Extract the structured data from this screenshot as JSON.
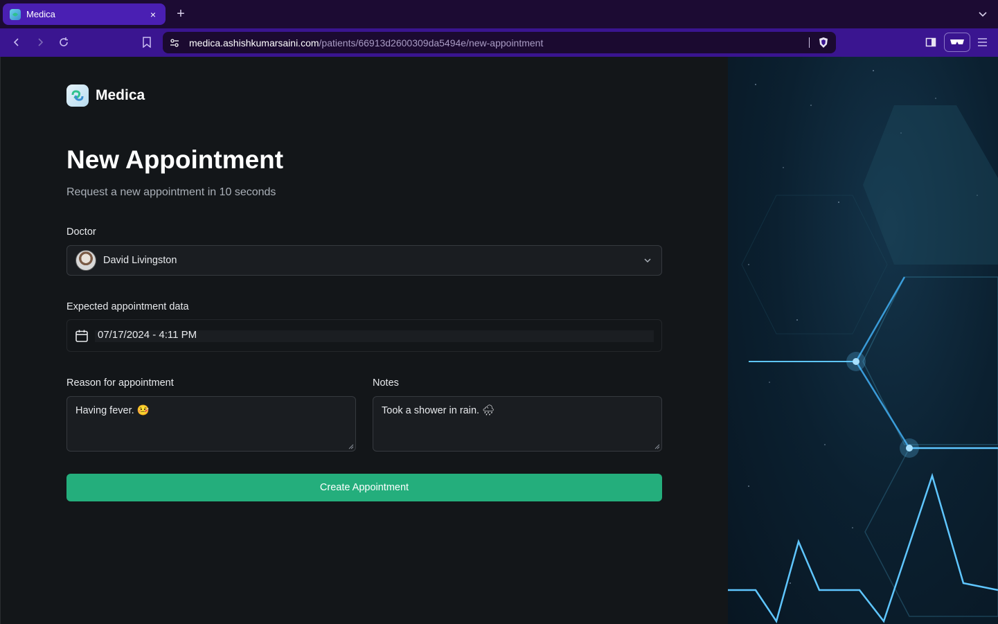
{
  "browser": {
    "tab_title": "Medica",
    "tab_close": "×",
    "new_tab": "+",
    "url_host": "medica.ashishkumarsaini.com",
    "url_path": "/patients/66913d2600309da5494e/new-appointment"
  },
  "brand": {
    "name": "Medica"
  },
  "form": {
    "title": "New Appointment",
    "subtitle": "Request a new appointment in 10 seconds",
    "doctor_label": "Doctor",
    "doctor_value": "David Livingston",
    "date_label": "Expected appointment data",
    "date_value": "07/17/2024 - 4:11 PM",
    "reason_label": "Reason for appointment",
    "reason_value": "Having fever. 🤒",
    "notes_label": "Notes",
    "notes_value": "Took a shower in rain. 🌧",
    "submit_label": "Create Appointment"
  },
  "colors": {
    "accent": "#24ae7c",
    "background": "#131619",
    "tab_active": "#4a1fb3",
    "toolbar": "#3a1590"
  },
  "icons": [
    "back-arrow-icon",
    "forward-arrow-icon",
    "reload-icon",
    "bookmark-icon",
    "site-settings-icon",
    "brave-shield-icon",
    "sidebar-icon",
    "reader-mode-icon",
    "menu-icon",
    "calendar-icon",
    "chevron-down-icon"
  ]
}
